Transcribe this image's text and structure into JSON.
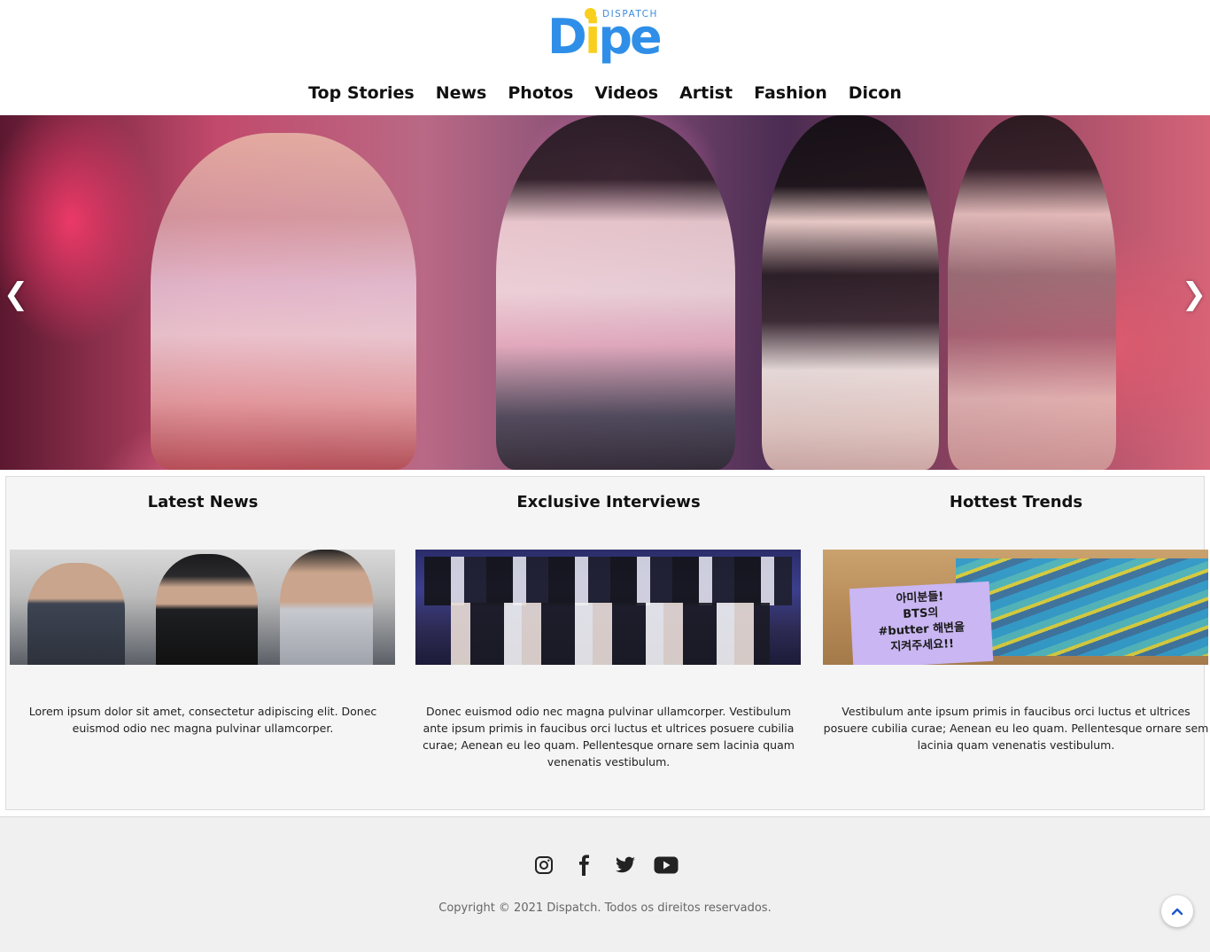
{
  "brand": {
    "logo_small": "DISPATCH",
    "logo_word": "Dipe",
    "primary_color": "#2f8fe8",
    "accent_color": "#f7cf1c"
  },
  "nav": {
    "items": [
      {
        "label": "Top Stories"
      },
      {
        "label": "News"
      },
      {
        "label": "Photos"
      },
      {
        "label": "Videos"
      },
      {
        "label": "Artist"
      },
      {
        "label": "Fashion"
      },
      {
        "label": "Dicon"
      }
    ]
  },
  "hero": {
    "prev_icon": "chevron-left-icon",
    "next_icon": "chevron-right-icon",
    "prev_symbol": "❮",
    "next_symbol": "❯"
  },
  "features": [
    {
      "title": "Latest News",
      "text": "Lorem ipsum dolor sit amet, consectetur adipiscing elit. Donec euismod odio nec magna pulvinar ullamcorper."
    },
    {
      "title": "Exclusive Interviews",
      "text": "Donec euismod odio nec magna pulvinar ullamcorper. Vestibulum ante ipsum primis in faucibus orci luctus et ultrices posuere cubilia curae; Aenean eu leo quam. Pellentesque ornare sem lacinia quam venenatis vestibulum."
    },
    {
      "title": "Hottest Trends",
      "text": "Vestibulum ante ipsum primis in faucibus orci luctus et ultrices posuere cubilia curae; Aenean eu leo quam. Pellentesque ornare sem lacinia quam venenatis vestibulum."
    }
  ],
  "trend_sign": {
    "line1": "아미분들!",
    "line2": "BTS의",
    "line3": "#butter 해변을",
    "line4": "지켜주세요!!"
  },
  "footer": {
    "socials": [
      "instagram-icon",
      "facebook-icon",
      "twitter-icon",
      "youtube-icon"
    ],
    "copyright": "Copyright © 2021 Dispatch. Todos os direitos reservados."
  }
}
